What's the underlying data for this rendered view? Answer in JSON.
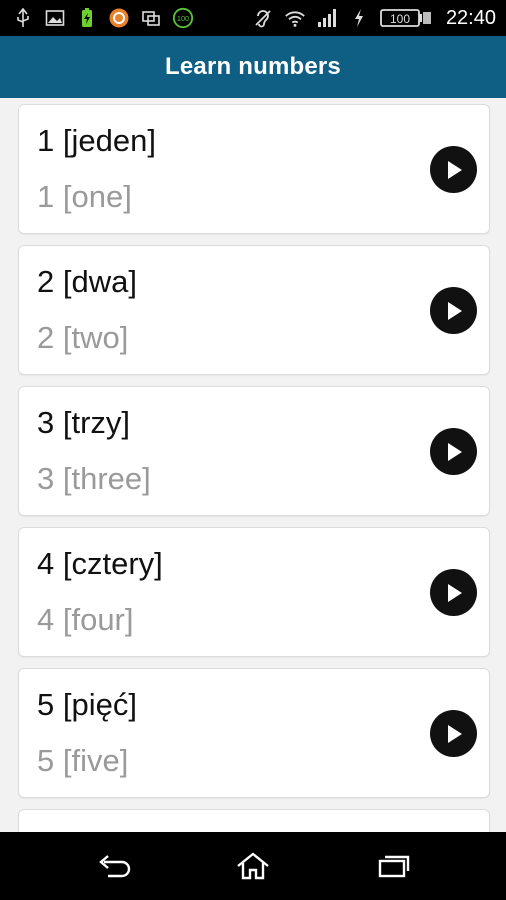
{
  "status_bar": {
    "time": "22:40",
    "battery_level": "100",
    "left_icons": [
      "usb-icon",
      "image-icon",
      "battery-saver-icon",
      "app-circle-icon",
      "screen-mirror-icon",
      "percent-100-icon"
    ],
    "right_icons": [
      "hearing-aid-icon",
      "wifi-icon",
      "signal-icon",
      "charging-icon",
      "battery-icon"
    ]
  },
  "app_bar": {
    "title": "Learn numbers",
    "color": "#0f5f84"
  },
  "items": [
    {
      "native": "1 [jeden]",
      "english": "1 [one]"
    },
    {
      "native": "2 [dwa]",
      "english": "2 [two]"
    },
    {
      "native": "3 [trzy]",
      "english": "3 [three]"
    },
    {
      "native": "4 [cztery]",
      "english": "4 [four]"
    },
    {
      "native": "5 [pięć]",
      "english": "5 [five]"
    },
    {
      "native": "",
      "english": ""
    }
  ],
  "nav_bar": {
    "buttons": [
      "back-icon",
      "home-icon",
      "recents-icon"
    ]
  }
}
